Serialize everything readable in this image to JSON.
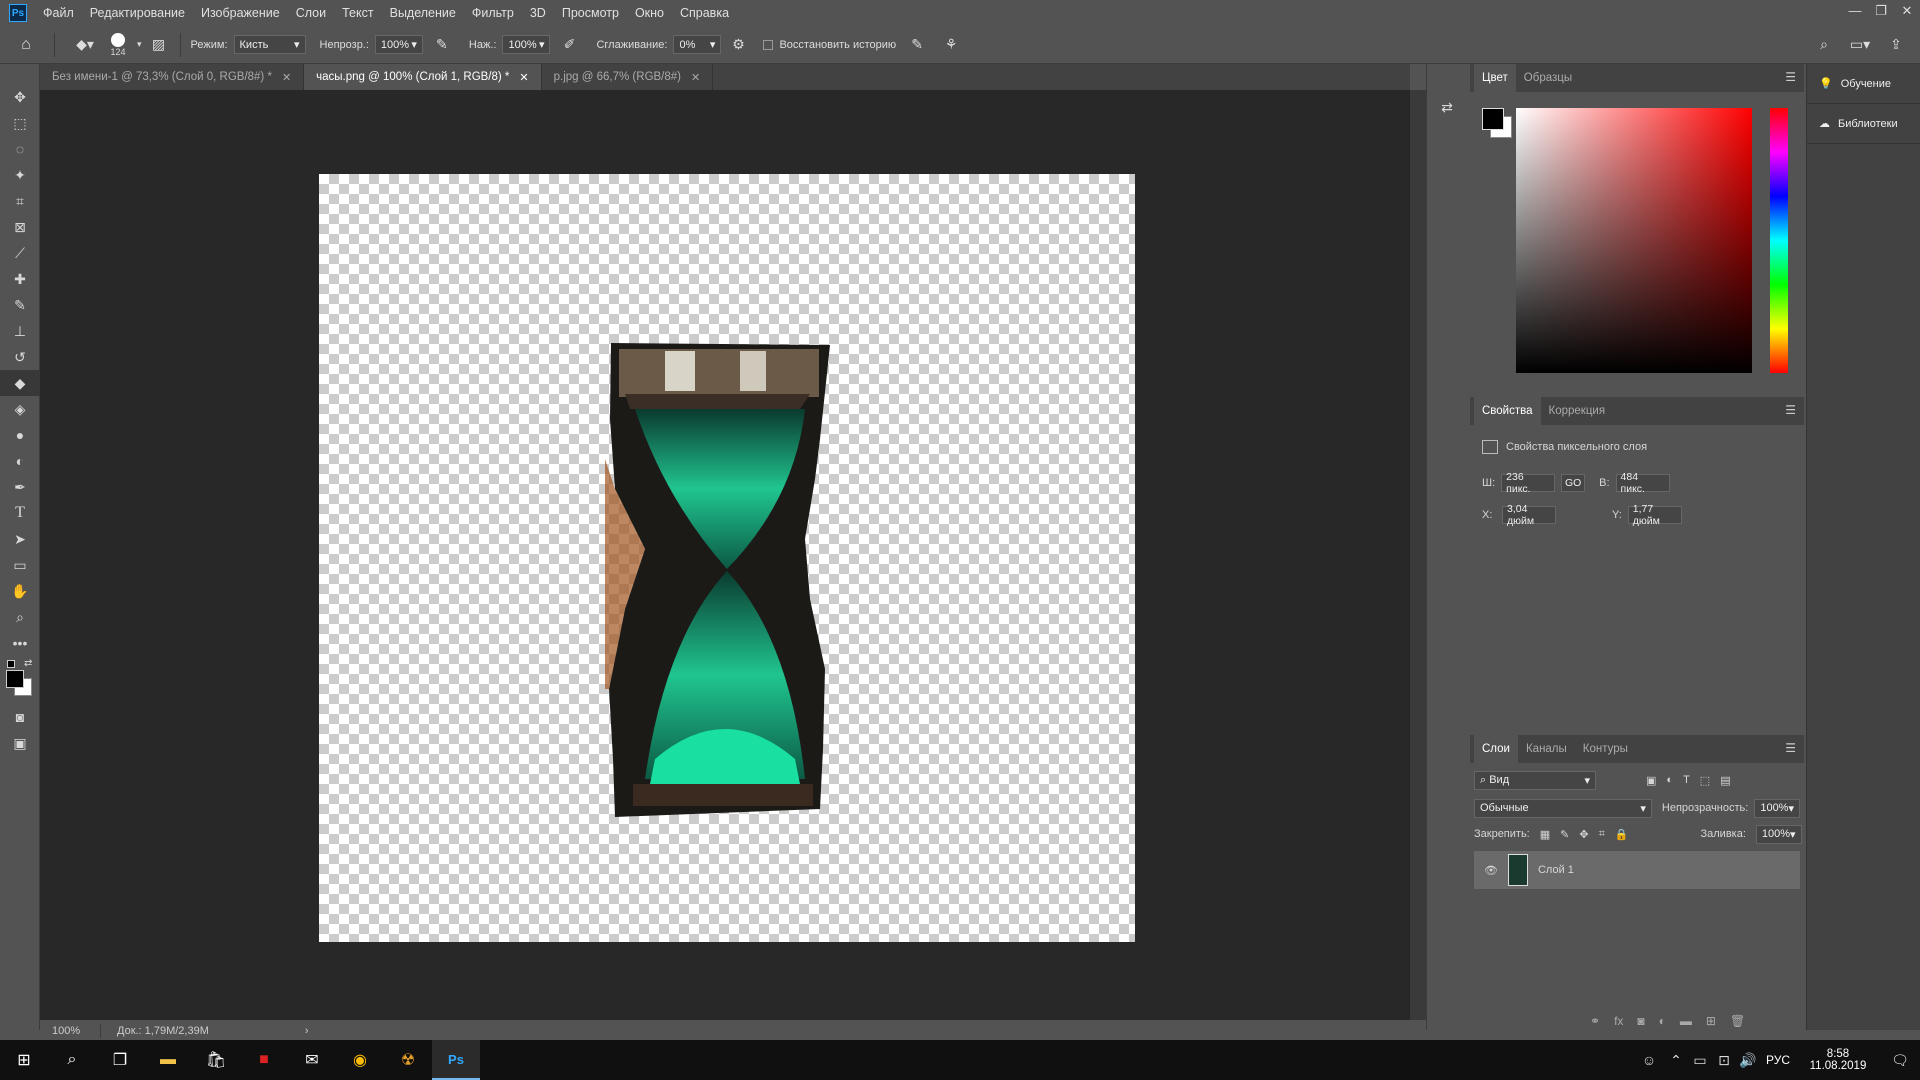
{
  "menu": [
    "Файл",
    "Редактирование",
    "Изображение",
    "Слои",
    "Текст",
    "Выделение",
    "Фильтр",
    "3D",
    "Просмотр",
    "Окно",
    "Справка"
  ],
  "app_logo": "Ps",
  "options": {
    "brush_size": "124",
    "mode_label": "Режим:",
    "mode_value": "Кисть",
    "opacity_label": "Непрозр.:",
    "opacity_value": "100%",
    "flow_label": "Наж.:",
    "flow_value": "100%",
    "smoothing_label": "Сглаживание:",
    "smoothing_value": "0%",
    "restore_history": "Восстановить историю"
  },
  "tabs": [
    {
      "label": "Без имени-1 @ 73,3% (Слой 0, RGB/8#) *"
    },
    {
      "label": "часы.png @ 100% (Слой 1, RGB/8) *"
    },
    {
      "label": "p.jpg @ 66,7% (RGB/8#)"
    }
  ],
  "status": {
    "zoom": "100%",
    "doc": "Док.: 1,79M/2,39M"
  },
  "color_panel": {
    "tabs": [
      "Цвет",
      "Образцы"
    ]
  },
  "properties_panel": {
    "tabs": [
      "Свойства",
      "Коррекция"
    ],
    "title": "Свойства пиксельного слоя",
    "w_label": "Ш:",
    "w_value": "236 пикс.",
    "link": "GO",
    "h_label": "В:",
    "h_value": "484 пикс.",
    "x_label": "X:",
    "x_value": "3,04 дюйм",
    "y_label": "Y:",
    "y_value": "1,77 дюйм"
  },
  "layers_panel": {
    "tabs": [
      "Слои",
      "Каналы",
      "Контуры"
    ],
    "filter": "Вид",
    "blend": "Обычные",
    "opacity_label": "Непрозрачность:",
    "opacity_value": "100%",
    "lock_label": "Закрепить:",
    "fill_label": "Заливка:",
    "fill_value": "100%",
    "layers": [
      {
        "name": "Слой 1"
      }
    ]
  },
  "learn_panel": {
    "learn": "Обучение",
    "libraries": "Библиотеки"
  },
  "taskbar": {
    "time": "8:58",
    "date": "11.08.2019",
    "lang": "РУС"
  },
  "colors": {
    "foreground": "#000000",
    "background": "#ffffff",
    "picker_hue": "#ff0000"
  }
}
